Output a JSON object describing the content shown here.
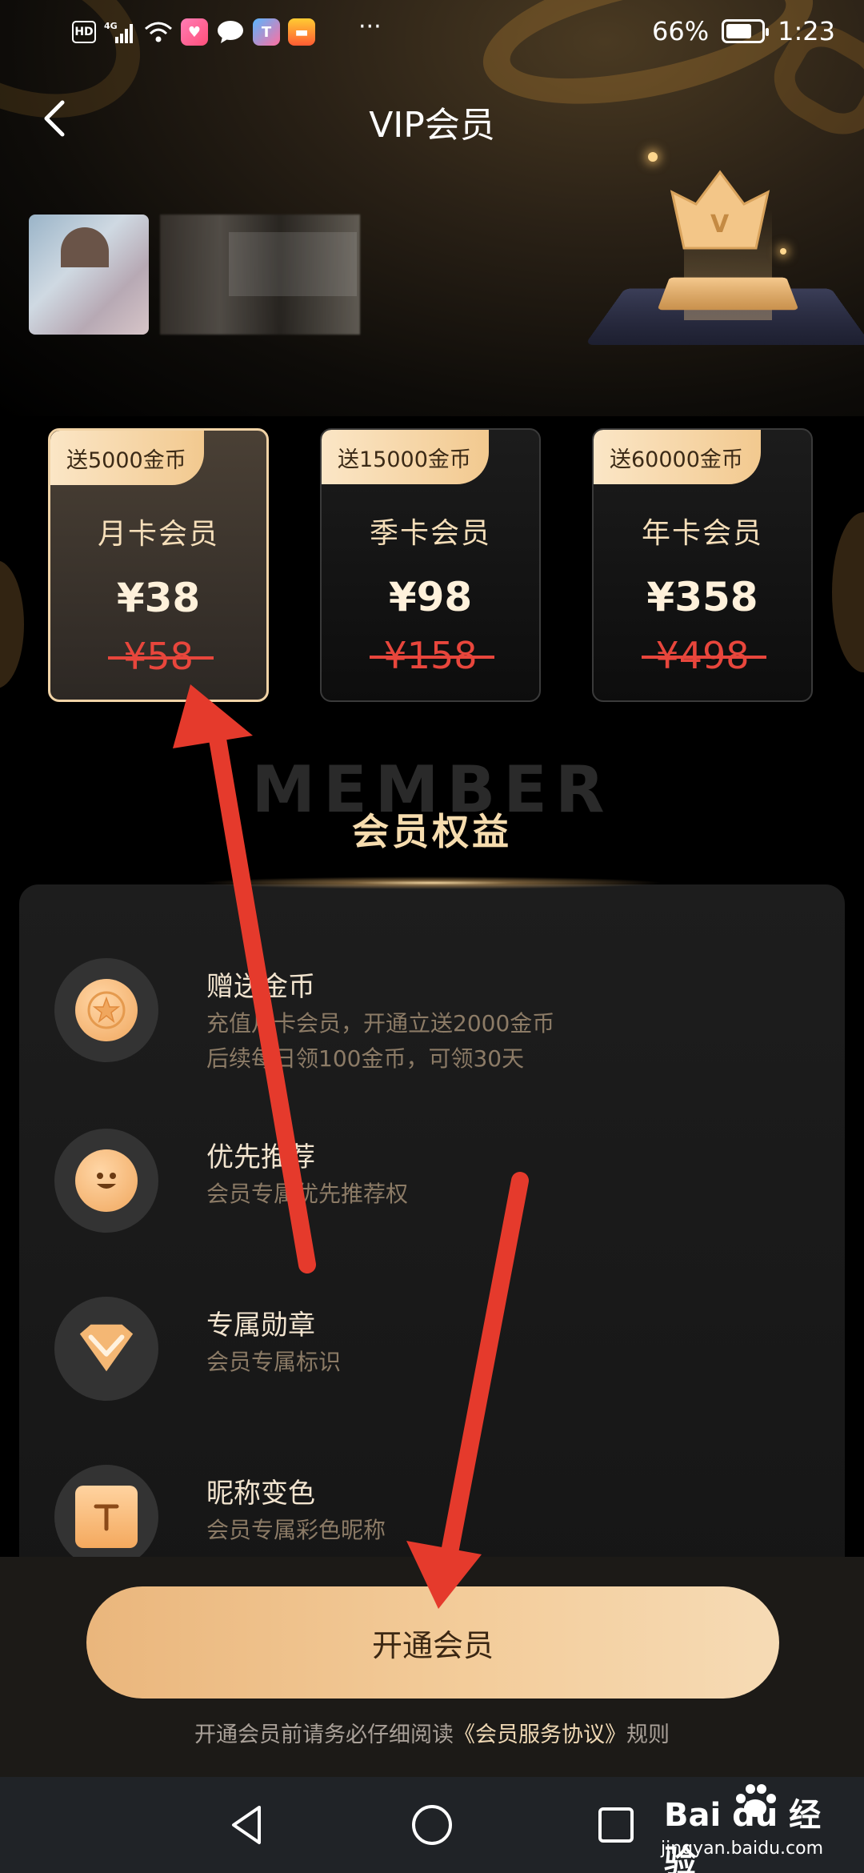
{
  "status_bar": {
    "left_icons": [
      "HD",
      "4G",
      "signal-icon",
      "wifi-icon",
      "app-icon-1",
      "message-icon",
      "app-icon-2",
      "app-icon-3"
    ],
    "more": "···",
    "battery_percent": "66%",
    "battery_level": 0.66,
    "time": "1:23"
  },
  "nav": {
    "title": "VIP会员"
  },
  "plans": [
    {
      "badge": "送5000金币",
      "name": "月卡会员",
      "price": "¥38",
      "original_price": "¥58",
      "selected": true
    },
    {
      "badge": "送15000金币",
      "name": "季卡会员",
      "price": "¥98",
      "original_price": "¥158",
      "selected": false
    },
    {
      "badge": "送60000金币",
      "name": "年卡会员",
      "price": "¥358",
      "original_price": "¥498",
      "selected": false
    }
  ],
  "member": {
    "watermark": "MEMBER",
    "title": "会员权益"
  },
  "benefits": [
    {
      "icon": "coin-icon",
      "title": "赠送金币",
      "desc": [
        "充值月卡会员，开通立送2000金币",
        "后续每日领100金币，可领30天"
      ]
    },
    {
      "icon": "smile-icon",
      "title": "优先推荐",
      "desc": [
        "会员专属优先推荐权"
      ]
    },
    {
      "icon": "badge-icon",
      "title": "专属勋章",
      "desc": [
        "会员专属标识"
      ]
    },
    {
      "icon": "nickname-color-icon",
      "title": "昵称变色",
      "desc": [
        "会员专属彩色昵称"
      ]
    }
  ],
  "action": {
    "button_label": "开通会员",
    "agreement_prefix": "开通会员前请务必仔细阅读",
    "agreement_link": "《会员服务协议》",
    "agreement_suffix": "规则"
  },
  "watermark": {
    "brand": "Bai du 经验",
    "url": "jingyan.baidu.com"
  },
  "colors": {
    "accent_gold": "#f6dcae",
    "button_gold": "#eab67c",
    "strike_red": "#e8463c",
    "annotation_arrow": "#e53a2c"
  }
}
